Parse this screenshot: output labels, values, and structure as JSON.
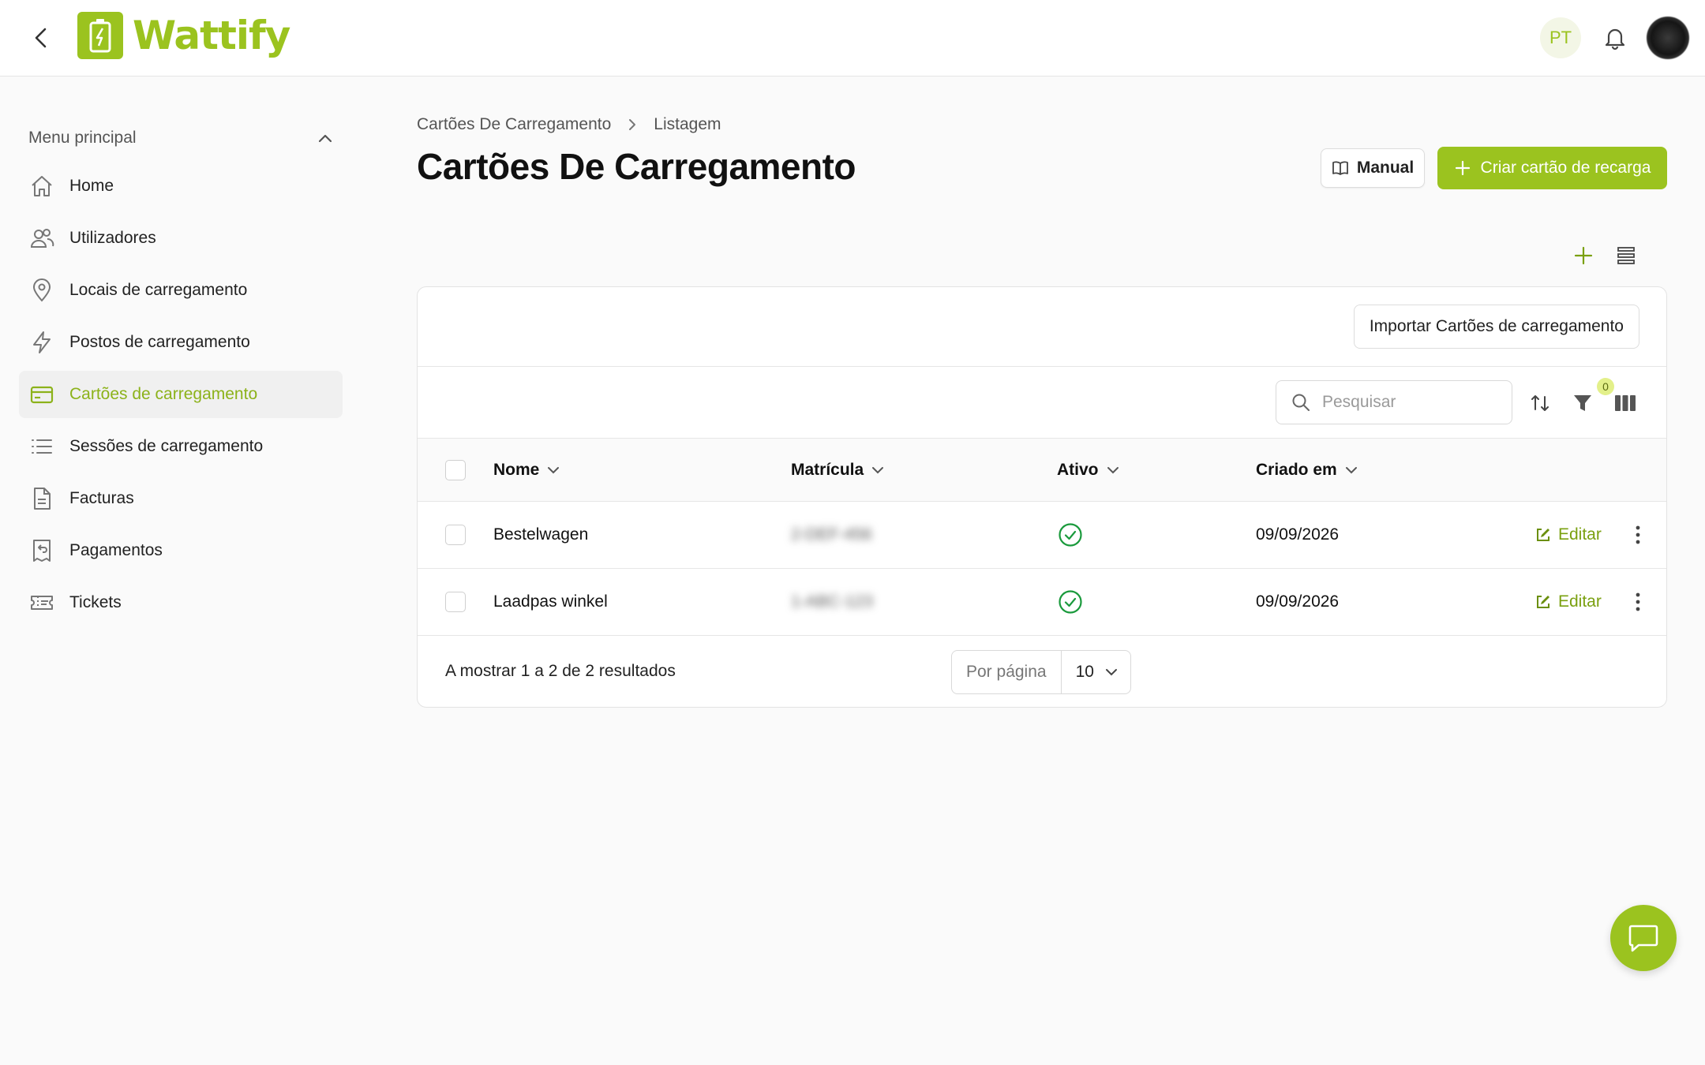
{
  "app": {
    "brand": "Wattify",
    "language_badge": "PT",
    "accent_color": "#9bc31f"
  },
  "sidebar": {
    "header": "Menu principal",
    "items": [
      {
        "label": "Home",
        "icon": "home-icon",
        "active": false
      },
      {
        "label": "Utilizadores",
        "icon": "users-icon",
        "active": false
      },
      {
        "label": "Locais de carregamento",
        "icon": "map-pin-icon",
        "active": false
      },
      {
        "label": "Postos de carregamento",
        "icon": "bolt-icon",
        "active": false
      },
      {
        "label": "Cartões de carregamento",
        "icon": "credit-card-icon",
        "active": true
      },
      {
        "label": "Sessões de carregamento",
        "icon": "list-icon",
        "active": false
      },
      {
        "label": "Facturas",
        "icon": "document-icon",
        "active": false
      },
      {
        "label": "Pagamentos",
        "icon": "receipt-refund-icon",
        "active": false
      },
      {
        "label": "Tickets",
        "icon": "ticket-icon",
        "active": false
      }
    ]
  },
  "breadcrumb": [
    "Cartões De Carregamento",
    "Listagem"
  ],
  "page": {
    "title": "Cartões De Carregamento",
    "manual_label": "Manual",
    "create_label": "Criar cartão de recarga"
  },
  "card": {
    "import_label": "Importar Cartões de carregamento",
    "search_placeholder": "Pesquisar",
    "filter_count": "0"
  },
  "table": {
    "columns": [
      "Nome",
      "Matrícula",
      "Ativo",
      "Criado em"
    ],
    "edit_label": "Editar",
    "rows": [
      {
        "name": "Bestelwagen",
        "plate": "2-DEF-456",
        "active": true,
        "created": "09/09/2026"
      },
      {
        "name": "Laadpas winkel",
        "plate": "1-ABC-123",
        "active": true,
        "created": "09/09/2026"
      }
    ]
  },
  "pagination": {
    "summary": "A mostrar 1 a 2 de 2 resultados",
    "per_page_label": "Por página",
    "per_page_value": "10"
  }
}
